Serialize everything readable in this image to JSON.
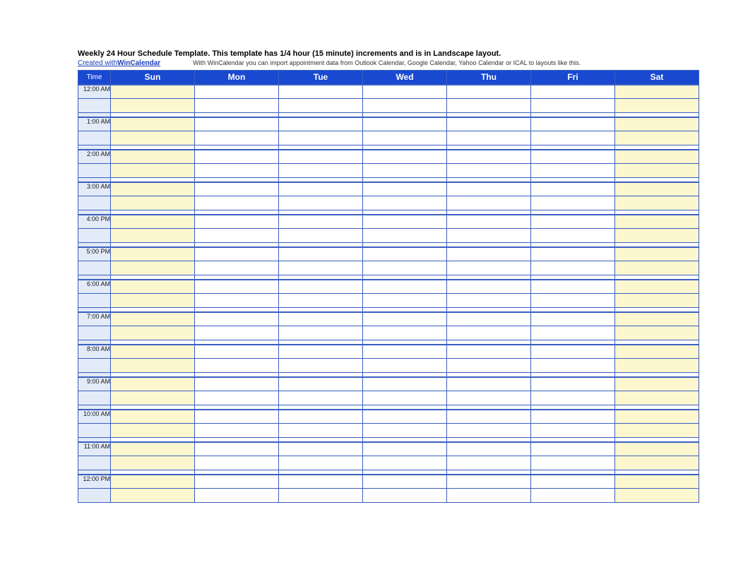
{
  "title": "Weekly 24 Hour Schedule Template.  This template has 1/4 hour (15 minute) increments and is in Landscape layout.",
  "credit_prefix": "Created with ",
  "credit_link": "WinCalendar",
  "import_note": "With WinCalendar you can import appointment data from Outlook Calendar, Google Calendar, Yahoo Calendar or ICAL to layouts like this.",
  "time_header": "Time",
  "days": [
    "Sun",
    "Mon",
    "Tue",
    "Wed",
    "Thu",
    "Fri",
    "Sat"
  ],
  "hours": [
    "12:00 AM",
    "1:00 AM",
    "2:00 AM",
    "3:00 AM",
    "4:00 PM",
    "5:00 PM",
    "6:00 AM",
    "7:00 AM",
    "8:00 AM",
    "9:00 AM",
    "10:00 AM",
    "11:00 AM",
    "12:00 PM"
  ],
  "weekend_indices": [
    0,
    6
  ]
}
